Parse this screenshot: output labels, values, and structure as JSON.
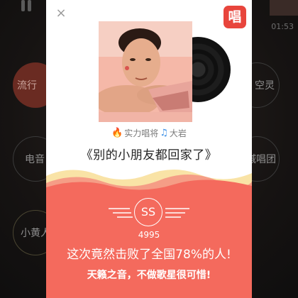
{
  "background": {
    "time": "01:53",
    "bubbles": {
      "left_1": "流行",
      "left_2": "电音",
      "left_3": "小黄人",
      "right_1": "空灵",
      "right_2": "喊唱团"
    }
  },
  "dialog": {
    "close_icon": "×",
    "logo_text": "唱",
    "singer_prefix": "实力唱将",
    "singer_name": "大岩",
    "song_title": "《别的小朋友都回家了》",
    "score_badge": "SS",
    "score_number": "4995",
    "beat_text": "这次竟然击败了全国78%的人!",
    "praise_text": "天籁之音，不做歌星很可惜!",
    "colors": {
      "accent_red": "#f46a5d",
      "logo_red": "#e8453c",
      "wave_yellow": "#f9e3a6"
    }
  }
}
